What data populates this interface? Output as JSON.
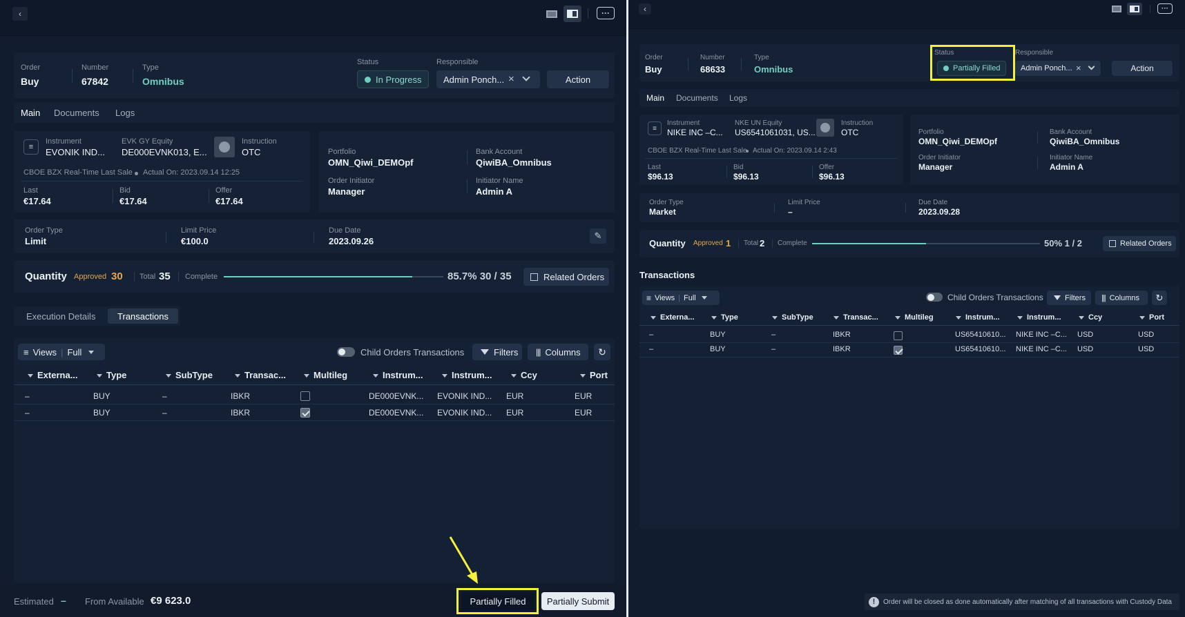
{
  "left": {
    "header": {
      "order_label": "Order",
      "order_value": "Buy",
      "number_label": "Number",
      "number_value": "67842",
      "type_label": "Type",
      "type_value": "Omnibus",
      "status_label": "Status",
      "status_value": "In Progress",
      "responsible_label": "Responsible",
      "responsible_value": "Admin Ponch...",
      "action_label": "Action"
    },
    "tabs": [
      "Main",
      "Documents",
      "Logs"
    ],
    "instrument": {
      "label": "Instrument",
      "value": "EVONIK IND...",
      "equity_label": "EVK GY Equity",
      "equity_value": "DE000EVNK013, E...",
      "instruction_label": "Instruction",
      "instruction_value": "OTC",
      "feed": "CBOE BZX Real-Time Last Sale",
      "actual": "Actual On: 2023.09.14 12:25",
      "last_label": "Last",
      "last_value": "€17.64",
      "bid_label": "Bid",
      "bid_value": "€17.64",
      "offer_label": "Offer",
      "offer_value": "€17.64"
    },
    "portfolio": {
      "portfolio_label": "Portfolio",
      "portfolio_value": "OMN_Qiwi_DEMOpf",
      "bank_label": "Bank Account",
      "bank_value": "QiwiBA_Omnibus",
      "initiator_label": "Order Initiator",
      "initiator_value": "Manager",
      "name_label": "Initiator Name",
      "name_value": "Admin A"
    },
    "order": {
      "type_label": "Order Type",
      "type_value": "Limit",
      "price_label": "Limit Price",
      "price_value": "€100.0",
      "due_label": "Due Date",
      "due_value": "2023.09.26"
    },
    "quantity": {
      "label": "Quantity",
      "approved_label": "Approved",
      "approved_value": "30",
      "total_label": "Total",
      "total_value": "35",
      "complete_label": "Complete",
      "progress": 0.857,
      "progress_text": "85.7% 30 / 35",
      "related": "Related Orders"
    },
    "subtabs": [
      "Execution Details",
      "Transactions"
    ],
    "toolbar": {
      "views": "Views",
      "full": "Full",
      "child": "Child Orders Transactions",
      "filters": "Filters",
      "columns": "Columns"
    },
    "columns": [
      "Externa...",
      "Type",
      "SubType",
      "Transac...",
      "Multileg",
      "Instrum...",
      "Instrum...",
      "Ccy",
      "Port"
    ],
    "rows": [
      {
        "ext": "–",
        "type": "BUY",
        "sub": "–",
        "trans": "IBKR",
        "multi": false,
        "i1": "DE000EVNK...",
        "i2": "EVONIK IND...",
        "ccy": "EUR",
        "port": "EUR"
      },
      {
        "ext": "–",
        "type": "BUY",
        "sub": "–",
        "trans": "IBKR",
        "multi": true,
        "i1": "DE000EVNK...",
        "i2": "EVONIK IND...",
        "ccy": "EUR",
        "port": "EUR"
      }
    ],
    "footer": {
      "estimated_label": "Estimated",
      "estimated_value": "–",
      "available_label": "From Available",
      "available_value": "€9 623.0",
      "btn1": "Partially Filled",
      "btn2": "Partially Submit"
    }
  },
  "right": {
    "header": {
      "order_label": "Order",
      "order_value": "Buy",
      "number_label": "Number",
      "number_value": "68633",
      "type_label": "Type",
      "type_value": "Omnibus",
      "status_label": "Status",
      "status_value": "Partially Filled",
      "responsible_label": "Responsible",
      "responsible_value": "Admin Ponch...",
      "action_label": "Action"
    },
    "tabs": [
      "Main",
      "Documents",
      "Logs"
    ],
    "instrument": {
      "label": "Instrument",
      "value": "NIKE INC –C...",
      "equity_label": "NKE UN Equity",
      "equity_value": "US6541061031, US...",
      "instruction_label": "Instruction",
      "instruction_value": "OTC",
      "feed": "CBOE BZX Real-Time Last Sale",
      "actual": "Actual On: 2023.09.14 2:43",
      "last_label": "Last",
      "last_value": "$96.13",
      "bid_label": "Bid",
      "bid_value": "$96.13",
      "offer_label": "Offer",
      "offer_value": "$96.13"
    },
    "portfolio": {
      "portfolio_label": "Portfolio",
      "portfolio_value": "OMN_Qiwi_DEMOpf",
      "bank_label": "Bank Account",
      "bank_value": "QiwiBA_Omnibus",
      "initiator_label": "Order Initiator",
      "initiator_value": "Manager",
      "name_label": "Initiator Name",
      "name_value": "Admin A"
    },
    "order": {
      "type_label": "Order Type",
      "type_value": "Market",
      "price_label": "Limit Price",
      "price_value": "–",
      "due_label": "Due Date",
      "due_value": "2023.09.28"
    },
    "quantity": {
      "label": "Quantity",
      "approved_label": "Approved",
      "approved_value": "1",
      "total_label": "Total",
      "total_value": "2",
      "complete_label": "Complete",
      "progress": 0.5,
      "progress_text": "50% 1 / 2",
      "related": "Related Orders"
    },
    "section_title": "Transactions",
    "toolbar": {
      "views": "Views",
      "full": "Full",
      "child": "Child Orders Transactions",
      "filters": "Filters",
      "columns": "Columns"
    },
    "columns": [
      "Externa...",
      "Type",
      "SubType",
      "Transac...",
      "Multileg",
      "Instrum...",
      "Instrum...",
      "Ccy",
      "Port"
    ],
    "rows": [
      {
        "ext": "–",
        "type": "BUY",
        "sub": "–",
        "trans": "IBKR",
        "multi": false,
        "i1": "US65410610...",
        "i2": "NIKE INC –C...",
        "ccy": "USD",
        "port": "USD"
      },
      {
        "ext": "–",
        "type": "BUY",
        "sub": "–",
        "trans": "IBKR",
        "multi": true,
        "i1": "US65410610...",
        "i2": "NIKE INC –C...",
        "ccy": "USD",
        "port": "USD"
      }
    ],
    "notice": "Order will be closed as done automatically after matching of all transactions with Custody Data"
  },
  "colors": {
    "accent": "#6fcfc0",
    "approved": "#e8a54b",
    "highlight": "#f4f13a"
  }
}
